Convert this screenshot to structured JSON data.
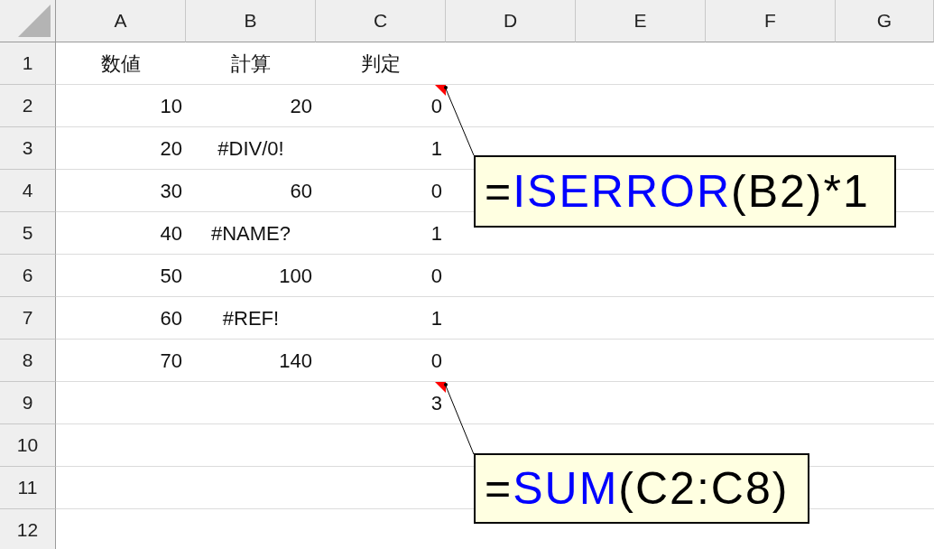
{
  "columns": [
    "A",
    "B",
    "C",
    "D",
    "E",
    "F",
    "G"
  ],
  "rows": [
    {
      "number": "1",
      "cells": [
        {
          "text": "数値",
          "kind": "text",
          "comment": false
        },
        {
          "text": "計算",
          "kind": "text",
          "comment": false
        },
        {
          "text": "判定",
          "kind": "text",
          "comment": false
        }
      ]
    },
    {
      "number": "2",
      "cells": [
        {
          "text": "10",
          "kind": "number",
          "comment": false
        },
        {
          "text": "20",
          "kind": "number",
          "comment": false
        },
        {
          "text": "0",
          "kind": "number",
          "comment": true
        }
      ]
    },
    {
      "number": "3",
      "cells": [
        {
          "text": "20",
          "kind": "number",
          "comment": false
        },
        {
          "text": "#DIV/0!",
          "kind": "error",
          "comment": false
        },
        {
          "text": "1",
          "kind": "number",
          "comment": false
        }
      ]
    },
    {
      "number": "4",
      "cells": [
        {
          "text": "30",
          "kind": "number",
          "comment": false
        },
        {
          "text": "60",
          "kind": "number",
          "comment": false
        },
        {
          "text": "0",
          "kind": "number",
          "comment": false
        }
      ]
    },
    {
      "number": "5",
      "cells": [
        {
          "text": "40",
          "kind": "number",
          "comment": false
        },
        {
          "text": "#NAME?",
          "kind": "error",
          "comment": false
        },
        {
          "text": "1",
          "kind": "number",
          "comment": false
        }
      ]
    },
    {
      "number": "6",
      "cells": [
        {
          "text": "50",
          "kind": "number",
          "comment": false
        },
        {
          "text": "100",
          "kind": "number",
          "comment": false
        },
        {
          "text": "0",
          "kind": "number",
          "comment": false
        }
      ]
    },
    {
      "number": "7",
      "cells": [
        {
          "text": "60",
          "kind": "number",
          "comment": false
        },
        {
          "text": "#REF!",
          "kind": "error",
          "comment": false
        },
        {
          "text": "1",
          "kind": "number",
          "comment": false
        }
      ]
    },
    {
      "number": "8",
      "cells": [
        {
          "text": "70",
          "kind": "number",
          "comment": false
        },
        {
          "text": "140",
          "kind": "number",
          "comment": false
        },
        {
          "text": "0",
          "kind": "number",
          "comment": false
        }
      ]
    },
    {
      "number": "9",
      "cells": [
        null,
        null,
        {
          "text": "3",
          "kind": "number",
          "comment": true
        }
      ]
    },
    {
      "number": "10"
    },
    {
      "number": "11"
    },
    {
      "number": "12"
    }
  ],
  "callouts": [
    {
      "parts": [
        {
          "text": "=",
          "kind": "plain"
        },
        {
          "text": "ISERROR",
          "kind": "function"
        },
        {
          "text": "(B2)*1",
          "kind": "plain"
        }
      ]
    },
    {
      "parts": [
        {
          "text": "=",
          "kind": "plain"
        },
        {
          "text": "SUM",
          "kind": "function"
        },
        {
          "text": "(C2:C8)",
          "kind": "plain"
        }
      ]
    }
  ]
}
